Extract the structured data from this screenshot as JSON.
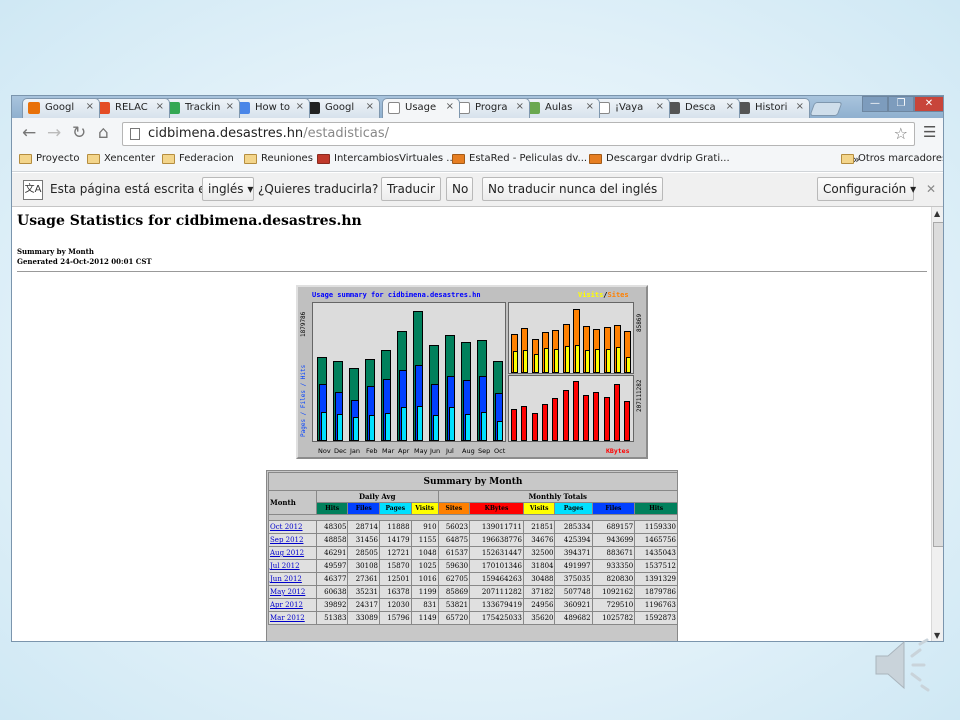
{
  "tabs": [
    {
      "label": "Googl",
      "icon": "analytics-icon",
      "color": "#e8710a"
    },
    {
      "label": "RELAC",
      "icon": "joomla-icon",
      "color": "#e44d26"
    },
    {
      "label": "Trackin",
      "icon": "drive-icon",
      "color": "#34a853"
    },
    {
      "label": "How to",
      "icon": "puzzle-icon",
      "color": "#4a86e8"
    },
    {
      "label": "Googl",
      "icon": "colored-grid-icon",
      "color": "#222222"
    },
    {
      "label": "Usage",
      "icon": "page-icon",
      "color": "#ffffff",
      "active": true
    },
    {
      "label": "Progra",
      "icon": "page-icon",
      "color": "#ffffff"
    },
    {
      "label": "Aulas",
      "icon": "puzzle-icon",
      "color": "#6aa84f"
    },
    {
      "label": "¡Vaya",
      "icon": "page-icon",
      "color": "#ffffff"
    },
    {
      "label": "Desca",
      "icon": "download-icon",
      "color": "#555555"
    },
    {
      "label": "Histori",
      "icon": "history-icon",
      "color": "#555555"
    }
  ],
  "tab_close": "×",
  "window_controls": {
    "minimize": "—",
    "maximize": "❐",
    "close": "✕"
  },
  "toolbar": {
    "back": "←",
    "forward": "→",
    "reload": "↻",
    "home": "⌂"
  },
  "address": {
    "host": "cidbimena.desastres.hn",
    "path": "/estadisticas/"
  },
  "bookmarks": [
    {
      "label": "Proyecto"
    },
    {
      "label": "Xencenter"
    },
    {
      "label": "Federacion"
    },
    {
      "label": "Reuniones"
    },
    {
      "label": "IntercambiosVirtuales ..."
    },
    {
      "label": "EstaRed - Peliculas dv..."
    },
    {
      "label": "Descargar dvdrip Grati..."
    }
  ],
  "bookmarks_more": "»",
  "other_bookmarks": "Otros marcadores",
  "translate": {
    "text1": "Esta página está escrita en",
    "language": "inglés",
    "text2": "¿Quieres traducirla?",
    "translate_btn": "Traducir",
    "no_btn": "No",
    "never_btn": "No traducir nunca del inglés",
    "config_btn": "Configuración",
    "close": "✕"
  },
  "page": {
    "title": "Usage Statistics for cidbimena.desastres.hn",
    "summary_by": "Summary by Month",
    "generated": "Generated 24-Oct-2012 00:01 CST"
  },
  "graph": {
    "title": "Usage summary for cidbimena.desastres.hn",
    "legend_visits": "Visits",
    "legend_sep": "/",
    "legend_sites": "Sites",
    "left_axis_max": "1879786",
    "left_axis_label": "Pages / Files / Hits",
    "right_top_max": "85869",
    "right_bottom_max": "207111282",
    "kbytes_label": "KBytes",
    "months": [
      "Nov",
      "Dec",
      "Jan",
      "Feb",
      "Mar",
      "Apr",
      "May",
      "Jun",
      "Jul",
      "Aug",
      "Sep",
      "Oct"
    ],
    "hits": [
      1210000,
      1150000,
      1050000,
      1180000,
      1320000,
      1592873,
      1879786,
      1391329,
      1537512,
      1435043,
      1465756,
      1159330
    ],
    "files": [
      820000,
      710000,
      600000,
      790000,
      900000,
      1025782,
      1092162,
      820830,
      933350,
      883671,
      943699,
      689157
    ],
    "pages": [
      420000,
      390000,
      340000,
      370000,
      410000,
      489682,
      507748,
      375035,
      491997,
      394371,
      425394,
      285334
    ],
    "visits": [
      30000,
      31000,
      25000,
      33000,
      32000,
      35620,
      37182,
      30488,
      31804,
      32500,
      34676,
      21851
    ],
    "sites": [
      52000,
      60000,
      46000,
      55000,
      58000,
      65720,
      85869,
      62705,
      59630,
      61537,
      64875,
      56023
    ],
    "kbytes": [
      110000000,
      120000000,
      98000000,
      126000000,
      150000000,
      175425033,
      207111282,
      159464263,
      170101346,
      152631447,
      196638776,
      139011711
    ]
  },
  "table": {
    "title": "Summary by Month",
    "month_header": "Month",
    "daily_avg": "Daily Avg",
    "monthly_totals": "Monthly Totals",
    "daily_cols": [
      "Hits",
      "Files",
      "Pages",
      "Visits"
    ],
    "monthly_cols": [
      "Sites",
      "KBytes",
      "Visits",
      "Pages",
      "Files",
      "Hits"
    ],
    "rows": [
      {
        "month": "Oct 2012",
        "v": [
          "48305",
          "28714",
          "11888",
          "910",
          "56023",
          "139011711",
          "21851",
          "285334",
          "689157",
          "1159330"
        ]
      },
      {
        "month": "Sep 2012",
        "v": [
          "48858",
          "31456",
          "14179",
          "1155",
          "64875",
          "196638776",
          "34676",
          "425394",
          "943699",
          "1465756"
        ]
      },
      {
        "month": "Aug 2012",
        "v": [
          "46291",
          "28505",
          "12721",
          "1048",
          "61537",
          "152631447",
          "32500",
          "394371",
          "883671",
          "1435043"
        ]
      },
      {
        "month": "Jul 2012",
        "v": [
          "49597",
          "30108",
          "15870",
          "1025",
          "59630",
          "170101346",
          "31804",
          "491997",
          "933350",
          "1537512"
        ]
      },
      {
        "month": "Jun 2012",
        "v": [
          "46377",
          "27361",
          "12501",
          "1016",
          "62705",
          "159464263",
          "30488",
          "375035",
          "820830",
          "1391329"
        ]
      },
      {
        "month": "May 2012",
        "v": [
          "60638",
          "35231",
          "16378",
          "1199",
          "85869",
          "207111282",
          "37182",
          "507748",
          "1092162",
          "1879786"
        ]
      },
      {
        "month": "Apr 2012",
        "v": [
          "39892",
          "24317",
          "12030",
          "831",
          "53821",
          "133679419",
          "24956",
          "360921",
          "729510",
          "1196763"
        ]
      },
      {
        "month": "Mar 2012",
        "v": [
          "51383",
          "33089",
          "15796",
          "1149",
          "65720",
          "175425033",
          "35620",
          "489682",
          "1025782",
          "1592873"
        ]
      }
    ]
  },
  "colors": {
    "hits": "#00805c",
    "files": "#0040ff",
    "pages": "#00e0ff",
    "visits": "#ffff00",
    "sites": "#ff8000",
    "kbytes": "#ff0000"
  }
}
